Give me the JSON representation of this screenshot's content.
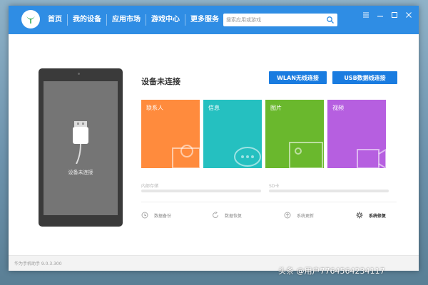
{
  "colors": {
    "titlebar": "#2f8de4",
    "button": "#1a7ce0",
    "contacts": "#ff8b3d",
    "messages": "#25c0c0",
    "photos": "#6ab82d",
    "videos": "#b65fe0",
    "phone_body": "#3a3a3a",
    "phone_screen": "#757575"
  },
  "nav": {
    "items": [
      {
        "label": "首页",
        "active": true
      },
      {
        "label": "我的设备"
      },
      {
        "label": "应用市场"
      },
      {
        "label": "游戏中心"
      },
      {
        "label": "更多服务"
      }
    ]
  },
  "search": {
    "placeholder": "搜索应用或游戏"
  },
  "window_controls": [
    "menu-icon",
    "minimize-icon",
    "maximize-icon",
    "close-icon"
  ],
  "device": {
    "status_title": "设备未连接",
    "screen_text": "设备未连接",
    "wlan_button": "WLAN无线连接",
    "usb_button": "USB数据线连接"
  },
  "tiles": [
    {
      "label": "联系人",
      "icon": "contacts-icon"
    },
    {
      "label": "信息",
      "icon": "message-icon"
    },
    {
      "label": "图片",
      "icon": "photo-icon"
    },
    {
      "label": "视频",
      "icon": "video-icon"
    }
  ],
  "storage": {
    "internal_label": "内部存储",
    "sd_label": "SD卡"
  },
  "actions": [
    {
      "label": "数据备份",
      "icon": "backup-icon"
    },
    {
      "label": "数据恢复",
      "icon": "restore-icon"
    },
    {
      "label": "系统更新",
      "icon": "update-icon"
    },
    {
      "label": "系统修复",
      "icon": "repair-icon"
    }
  ],
  "footer": {
    "version": "华为手机助手 9.0.3.300"
  },
  "watermark": "头条 @用户7764564234117"
}
